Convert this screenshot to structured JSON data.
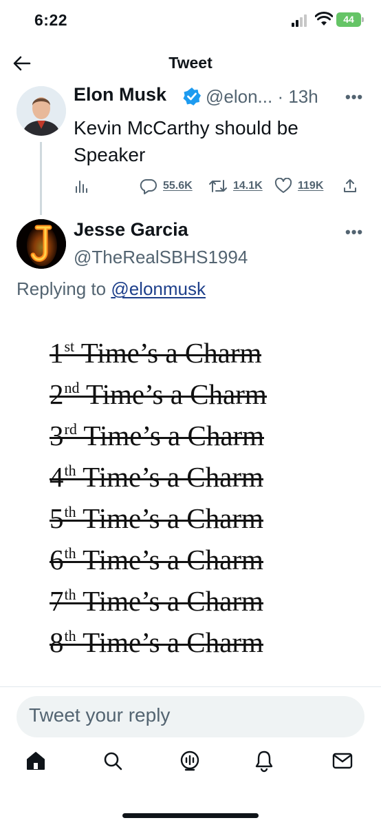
{
  "status_bar": {
    "time": "6:22",
    "battery": "44"
  },
  "header": {
    "title": "Tweet"
  },
  "tweet": {
    "author_name": "Elon Musk",
    "handle": "@elon...",
    "time_sep": " · 13h",
    "text": "Kevin McCarthy should be Speaker",
    "replies": "55.6K",
    "retweets": "14.1K",
    "likes": "119K"
  },
  "reply": {
    "author_name": "Jesse Garcia",
    "handle": "@TheRealSBHS1994",
    "replying_prefix": "Replying to ",
    "replying_to": "@elonmusk",
    "meme_lines": [
      {
        "num": "1",
        "sup": "st",
        "text": "Time’s a Charm"
      },
      {
        "num": "2",
        "sup": "nd",
        "text": "Time’s a Charm"
      },
      {
        "num": "3",
        "sup": "rd",
        "text": "Time’s a Charm"
      },
      {
        "num": "4",
        "sup": "th",
        "text": "Time’s a Charm"
      },
      {
        "num": "5",
        "sup": "th",
        "text": "Time’s a Charm"
      },
      {
        "num": "6",
        "sup": "th",
        "text": "Time’s a Charm"
      },
      {
        "num": "7",
        "sup": "th",
        "text": "Time’s a Charm"
      },
      {
        "num": "8",
        "sup": "th",
        "text": "Time’s a Charm"
      }
    ]
  },
  "composer": {
    "placeholder": "Tweet your reply"
  },
  "tabs": [
    "home-icon",
    "search-icon",
    "spaces-icon",
    "notifications-icon",
    "messages-icon"
  ],
  "colors": {
    "verified": "#1d9bf0",
    "battery": "#65c466",
    "link": "#1d3f8a"
  }
}
